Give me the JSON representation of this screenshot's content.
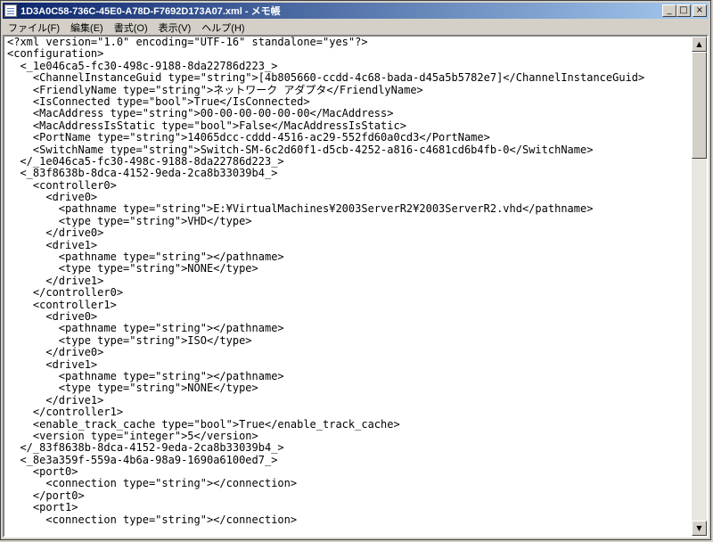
{
  "window": {
    "title": "1D3A0C58-736C-45E0-A78D-F7692D173A07.xml - メモ帳",
    "minimize_glyph": "_",
    "maximize_glyph": "□",
    "close_glyph": "×"
  },
  "menu": {
    "items": [
      "ファイル(F)",
      "編集(E)",
      "書式(O)",
      "表示(V)",
      "ヘルプ(H)"
    ]
  },
  "scrollbar": {
    "up_glyph": "▲",
    "down_glyph": "▼",
    "position_fraction": 0.0
  },
  "content": {
    "lines": [
      "<?xml version=\"1.0\" encoding=\"UTF-16\" standalone=\"yes\"?>",
      "<configuration>",
      "  <_1e046ca5-fc30-498c-9188-8da22786d223_>",
      "    <ChannelInstanceGuid type=\"string\">[4b805660-ccdd-4c68-bada-d45a5b5782e7]</ChannelInstanceGuid>",
      "    <FriendlyName type=\"string\">ネットワーク アダプタ</FriendlyName>",
      "    <IsConnected type=\"bool\">True</IsConnected>",
      "    <MacAddress type=\"string\">00-00-00-00-00-00</MacAddress>",
      "    <MacAddressIsStatic type=\"bool\">False</MacAddressIsStatic>",
      "    <PortName type=\"string\">14065dcc-cddd-4516-ac29-552fd60a0cd3</PortName>",
      "    <SwitchName type=\"string\">Switch-SM-6c2d60f1-d5cb-4252-a816-c4681cd6b4fb-0</SwitchName>",
      "  </_1e046ca5-fc30-498c-9188-8da22786d223_>",
      "  <_83f8638b-8dca-4152-9eda-2ca8b33039b4_>",
      "    <controller0>",
      "      <drive0>",
      "        <pathname type=\"string\">E:¥VirtualMachines¥2003ServerR2¥2003ServerR2.vhd</pathname>",
      "        <type type=\"string\">VHD</type>",
      "      </drive0>",
      "      <drive1>",
      "        <pathname type=\"string\"></pathname>",
      "        <type type=\"string\">NONE</type>",
      "      </drive1>",
      "    </controller0>",
      "    <controller1>",
      "      <drive0>",
      "        <pathname type=\"string\"></pathname>",
      "        <type type=\"string\">ISO</type>",
      "      </drive0>",
      "      <drive1>",
      "        <pathname type=\"string\"></pathname>",
      "        <type type=\"string\">NONE</type>",
      "      </drive1>",
      "    </controller1>",
      "    <enable_track_cache type=\"bool\">True</enable_track_cache>",
      "    <version type=\"integer\">5</version>",
      "  </_83f8638b-8dca-4152-9eda-2ca8b33039b4_>",
      "  <_8e3a359f-559a-4b6a-98a9-1690a6100ed7_>",
      "    <port0>",
      "      <connection type=\"string\"></connection>",
      "    </port0>",
      "    <port1>",
      "      <connection type=\"string\"></connection>"
    ]
  }
}
